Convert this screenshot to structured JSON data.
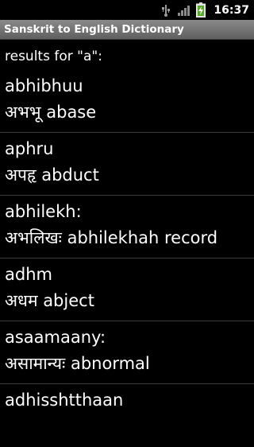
{
  "status_bar": {
    "time": "16:37",
    "icons": [
      "usb-icon",
      "signal-icon",
      "battery-charging-icon"
    ]
  },
  "app": {
    "title": "Sanskrit to English Dictionary"
  },
  "results": {
    "header": "results for \"a\":",
    "items": [
      {
        "word": "abhibhuu",
        "meaning": "अभभू abase"
      },
      {
        "word": "aphru",
        "meaning": "अपहृ abduct"
      },
      {
        "word": "abhilekh:",
        "meaning": "अभलिखः abhilekhah record"
      },
      {
        "word": "adhm",
        "meaning": "अधम abject"
      },
      {
        "word": "asaamaany:",
        "meaning": "असामान्यः abnormal"
      },
      {
        "word": "adhisshtthaan",
        "meaning": ""
      }
    ]
  },
  "colors": {
    "background": "#000000",
    "title_bar": "#6e6e6e",
    "divider": "#3c3c3c",
    "text": "#ffffff"
  }
}
